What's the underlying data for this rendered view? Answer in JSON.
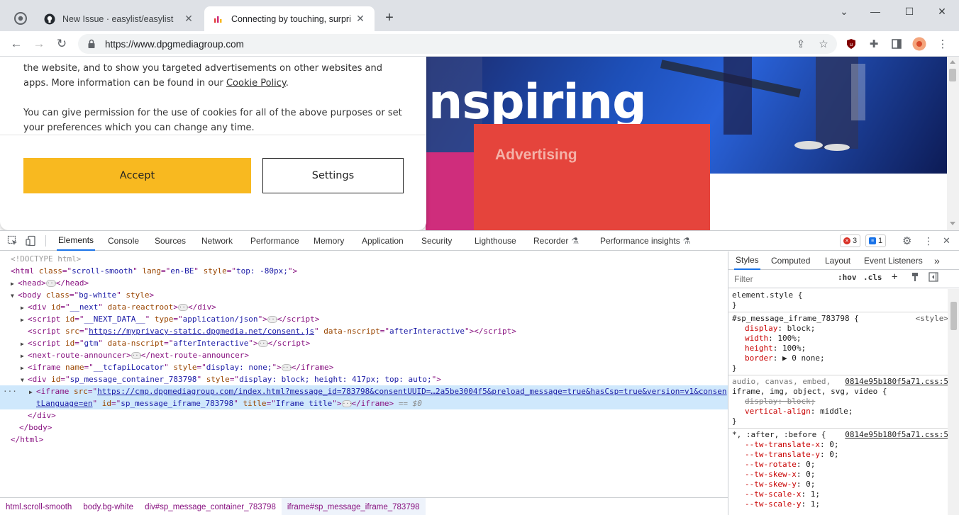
{
  "browser": {
    "tabs": [
      {
        "title": "New Issue · easylist/easylist",
        "active": false
      },
      {
        "title": "Connecting by touching, surprising",
        "active": true
      }
    ],
    "new_tab": "+",
    "window": {
      "minimize": "⌄",
      "min": "—",
      "max": "☐",
      "close": "✕"
    },
    "url": "https://www.dpgmediagroup.com"
  },
  "page": {
    "hero_text": "nspiring",
    "block_label": "Advertising",
    "cookie": {
      "paragraph1_a": "the website, and to show you targeted advertisements on other websites and apps. More information can be found in our ",
      "paragraph1_link": "Cookie Policy",
      "paragraph1_b": ".",
      "paragraph2": "You can give permission for the use of cookies for all of the above purposes or set your preferences which you can change any time.",
      "accept_label": "Accept",
      "settings_label": "Settings"
    },
    "colors": {
      "accept": "#f8b920",
      "advertising_block": "#e5443c",
      "magenta": "#cf2d7c"
    }
  },
  "devtools": {
    "tabs": [
      "Elements",
      "Console",
      "Sources",
      "Network",
      "Performance",
      "Memory",
      "Application",
      "Security",
      "Lighthouse",
      "Recorder",
      "Performance insights"
    ],
    "errors_count": "3",
    "messages_count": "1",
    "dom": {
      "doctype": "<!DOCTYPE html>",
      "html_open": {
        "tag": "html",
        "attrs": [
          [
            "class",
            "scroll-smooth"
          ],
          [
            "lang",
            "en-BE"
          ],
          [
            "style",
            "top: -80px;"
          ]
        ]
      },
      "head": "head",
      "body_open": {
        "tag": "body",
        "attrs": [
          [
            "class",
            "bg-white"
          ]
        ],
        "bare": "style"
      },
      "div_next": {
        "attrs": [
          [
            "id",
            "__next"
          ]
        ],
        "bare": "data-reactroot"
      },
      "script_next_data": {
        "attrs": [
          [
            "id",
            "__NEXT_DATA__"
          ],
          [
            "type",
            "application/json"
          ]
        ]
      },
      "script_consent": {
        "src": "https://myprivacy-static.dpgmedia.net/consent.js",
        "attrs": [
          [
            "data-nscript",
            "afterInteractive"
          ]
        ]
      },
      "script_gtm": {
        "attrs": [
          [
            "id",
            "gtm"
          ],
          [
            "data-nscript",
            "afterInteractive"
          ]
        ]
      },
      "next_route": "next-route-announcer",
      "iframe_locator": {
        "attrs": [
          [
            "name",
            "__tcfapiLocator"
          ],
          [
            "style",
            "display: none;"
          ]
        ]
      },
      "div_sp": {
        "attrs": [
          [
            "id",
            "sp_message_container_783798"
          ],
          [
            "style",
            "display: block; height: 417px; top: auto;"
          ]
        ]
      },
      "iframe_sp": {
        "src_a": "https://cmp.dpgmediagroup.com/index.html?message_id=783798&consentUUID=…2a5be3004f5&preload_message=true&hasCsp=true&version=v1&consen",
        "src_b": "tLanguage=en",
        "attrs": [
          [
            "id",
            "sp_message_iframe_783798"
          ],
          [
            "title",
            "Iframe title"
          ]
        ],
        "eq": "== $0"
      }
    },
    "breadcrumbs": [
      "html.scroll-smooth",
      "body.bg-white",
      "div#sp_message_container_783798",
      "iframe#sp_message_iframe_783798"
    ],
    "styles": {
      "tabs": [
        "Styles",
        "Computed",
        "Layout",
        "Event Listeners"
      ],
      "more": "»",
      "filter_placeholder": "Filter",
      "hov": ":hov",
      "cls": ".cls",
      "plus": "+",
      "rules": [
        {
          "selector": "element.style {",
          "source": "",
          "decls": [],
          "close": "}"
        },
        {
          "selector": "#sp_message_iframe_783798 {",
          "source": "<style>",
          "source_plain": true,
          "decls": [
            [
              "display",
              "block;"
            ],
            [
              "width",
              "100%;"
            ],
            [
              "height",
              "100%;"
            ],
            [
              "border",
              "▶ 0 none;"
            ]
          ],
          "close": "}"
        },
        {
          "selector_grey": "audio, canvas, embed,",
          "selector": "iframe, img, object, svg, video {",
          "source": "0814e95b180f5a71.css:5",
          "decls": [
            [
              "display",
              "block;",
              "strike"
            ],
            [
              "vertical-align",
              "middle;"
            ]
          ],
          "close": "}"
        },
        {
          "selector": "*, :after, :before {",
          "source": "0814e95b180f5a71.css:5",
          "decls": [
            [
              "--tw-translate-x",
              "0;"
            ],
            [
              "--tw-translate-y",
              "0;"
            ],
            [
              "--tw-rotate",
              "0;"
            ],
            [
              "--tw-skew-x",
              "0;"
            ],
            [
              "--tw-skew-y",
              "0;"
            ],
            [
              "--tw-scale-x",
              "1;"
            ],
            [
              "--tw-scale-y",
              "1;"
            ]
          ],
          "close": ""
        }
      ]
    }
  }
}
